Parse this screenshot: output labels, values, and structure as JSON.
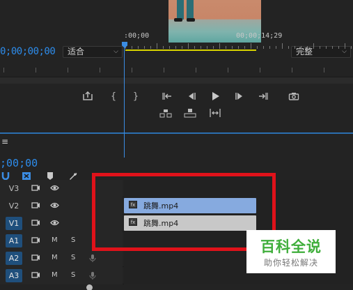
{
  "monitor": {
    "timecode": "0;00;00;00",
    "fit_label": "适合",
    "quality_label": "完整"
  },
  "controls": {
    "row1": [
      "export-frame",
      "mark-in",
      "mark-out",
      "go-to-in",
      "step-back",
      "play",
      "step-forward",
      "go-to-out",
      "camera"
    ],
    "row2": [
      "lift",
      "extract",
      "trim"
    ]
  },
  "timeline": {
    "menu_glyph": "≡",
    "timecode": ";00;00",
    "ruler_start": ":00;00",
    "ruler_end": "00;00;14;29",
    "tracks": [
      {
        "label": "V3",
        "active": false,
        "kind": "video"
      },
      {
        "label": "V2",
        "active": false,
        "kind": "video"
      },
      {
        "label": "V1",
        "active": true,
        "kind": "video"
      },
      {
        "label": "A1",
        "active": true,
        "kind": "audio",
        "m": "M",
        "s": "S"
      },
      {
        "label": "A2",
        "active": true,
        "kind": "audio",
        "m": "M",
        "s": "S"
      },
      {
        "label": "A3",
        "active": true,
        "kind": "audio",
        "m": "M",
        "s": "S"
      }
    ],
    "clips": {
      "v2": {
        "name": "跳舞.mp4",
        "fx": "fx"
      },
      "v1": {
        "name": "跳舞.mp4",
        "fx": "fx"
      }
    }
  },
  "watermark": {
    "title": "百科全说",
    "subtitle": "助你轻松解决"
  },
  "colors": {
    "timecode": "#2d8ceb",
    "highlight": "#e0121a",
    "clip_v2": "#86aadf",
    "clip_v1": "#c8c8c8",
    "work_area": "#d8d300"
  }
}
